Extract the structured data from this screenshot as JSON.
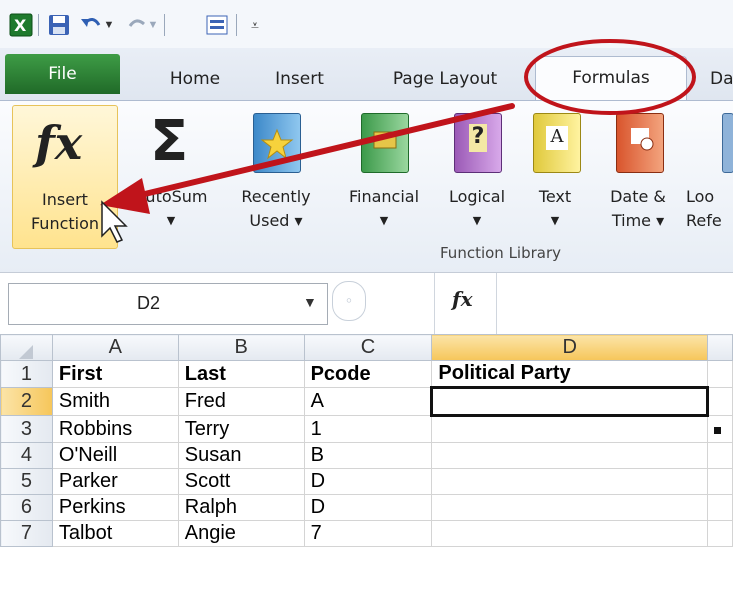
{
  "ribbon": {
    "tabs": {
      "file": "File",
      "home": "Home",
      "insert": "Insert",
      "page_layout": "Page Layout",
      "formulas": "Formulas",
      "data_partial": "Da"
    },
    "buttons": {
      "insert_function": [
        "Insert",
        "Function"
      ],
      "insert_function_icon": "fx",
      "autosum": "AutoSum",
      "autosum_icon": "Σ",
      "recently_used": [
        "Recently",
        "Used ▾"
      ],
      "financial": "Financial",
      "logical": "Logical",
      "text": "Text",
      "date_time": [
        "Date &",
        "Time ▾"
      ],
      "lookup_partial": [
        "Loo",
        "Refe"
      ],
      "logical_icon": "?",
      "text_icon": "A"
    },
    "group_label": "Function Library"
  },
  "formula_bar": {
    "name_box": "D2",
    "fx": "fx",
    "formula": ""
  },
  "sheet": {
    "columns": [
      "A",
      "B",
      "C",
      "D"
    ],
    "rows": [
      {
        "n": "1",
        "cells": [
          "First",
          "Last",
          "Pcode",
          "Political Party"
        ]
      },
      {
        "n": "2",
        "cells": [
          "Smith",
          "Fred",
          "A",
          ""
        ]
      },
      {
        "n": "3",
        "cells": [
          "Robbins",
          "Terry",
          "1",
          ""
        ]
      },
      {
        "n": "4",
        "cells": [
          "O'Neill",
          "Susan",
          "B",
          ""
        ]
      },
      {
        "n": "5",
        "cells": [
          "Parker",
          "Scott",
          "D",
          ""
        ]
      },
      {
        "n": "6",
        "cells": [
          "Perkins",
          "Ralph",
          "D",
          ""
        ]
      },
      {
        "n": "7",
        "cells": [
          "Talbot",
          "Angie",
          "7",
          ""
        ]
      }
    ],
    "selected_cell": "D2"
  },
  "colors": {
    "file_tab": "#2f8a37",
    "annotation": "#c0141b",
    "selected_header": "#f6c65a"
  }
}
